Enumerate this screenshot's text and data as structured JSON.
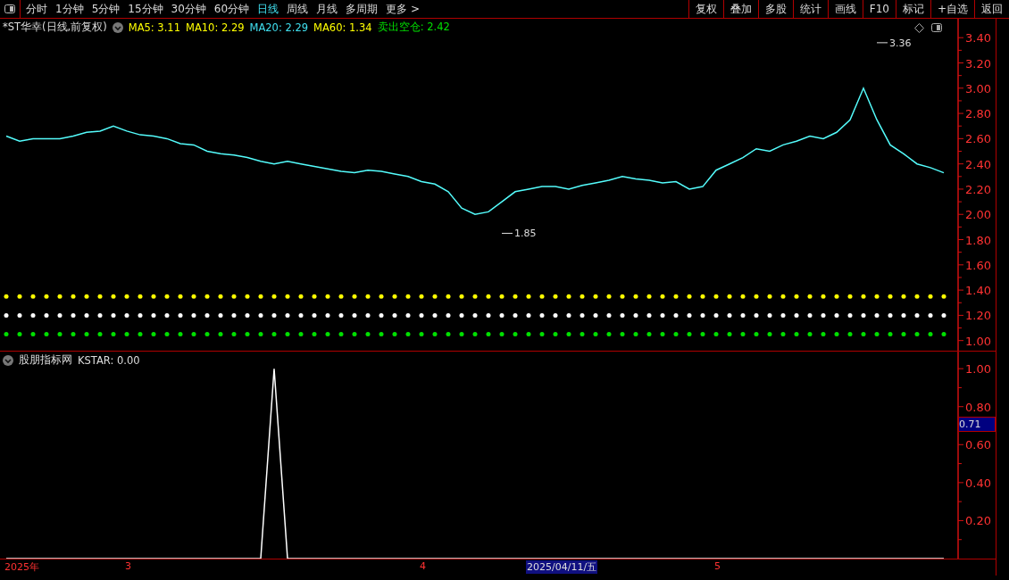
{
  "toolbar": {
    "periods": [
      {
        "label": "分时",
        "selected": false
      },
      {
        "label": "1分钟",
        "selected": false
      },
      {
        "label": "5分钟",
        "selected": false
      },
      {
        "label": "15分钟",
        "selected": false
      },
      {
        "label": "30分钟",
        "selected": false
      },
      {
        "label": "60分钟",
        "selected": false
      },
      {
        "label": "日线",
        "selected": true
      },
      {
        "label": "周线",
        "selected": false
      },
      {
        "label": "月线",
        "selected": false
      },
      {
        "label": "多周期",
        "selected": false
      },
      {
        "label": "更多 >",
        "selected": false
      }
    ],
    "buttons": [
      "复权",
      "叠加",
      "多股",
      "统计",
      "画线",
      "F10",
      "标记",
      "+自选",
      "返回"
    ]
  },
  "main_panel": {
    "title": "*ST华幸(日线,前复权)",
    "legend": [
      {
        "label": "MA5: 3.11",
        "color": "#ffff00"
      },
      {
        "label": "MA10: 2.29",
        "color": "#ffff00"
      },
      {
        "label": "MA20: 2.29",
        "color": "#40e0f0"
      },
      {
        "label": "MA60: 1.34",
        "color": "#ffff00"
      },
      {
        "label": "卖出空仓: 2.42",
        "color": "#00e000"
      }
    ],
    "price_marks": [
      {
        "label": "3.36"
      },
      {
        "label": "1.85"
      }
    ],
    "dot_rows": [
      {
        "color": "#ffff00"
      },
      {
        "color": "#ffffff"
      },
      {
        "color": "#00e000"
      }
    ],
    "chart_data": {
      "type": "line",
      "ylim": [
        0.92,
        3.55
      ],
      "yticks": [
        {
          "value": 3.4,
          "label": "3.40"
        },
        {
          "value": 3.2,
          "label": "3.20"
        },
        {
          "value": 3.0,
          "label": "3.00"
        },
        {
          "value": 2.8,
          "label": "2.80"
        },
        {
          "value": 2.6,
          "label": "2.60"
        },
        {
          "value": 2.4,
          "label": "2.40"
        },
        {
          "value": 2.2,
          "label": "2.20"
        },
        {
          "value": 2.0,
          "label": "2.00"
        },
        {
          "value": 1.8,
          "label": "1.80"
        },
        {
          "value": 1.6,
          "label": "1.60"
        },
        {
          "value": 1.4,
          "label": "1.40"
        },
        {
          "value": 1.2,
          "label": "1.20"
        },
        {
          "value": 1.0,
          "label": "1.00"
        }
      ],
      "series": [
        {
          "color": "#54fcfc",
          "values": [
            2.62,
            2.58,
            2.6,
            2.6,
            2.6,
            2.62,
            2.65,
            2.66,
            2.7,
            2.66,
            2.63,
            2.62,
            2.6,
            2.56,
            2.55,
            2.5,
            2.48,
            2.47,
            2.45,
            2.42,
            2.4,
            2.42,
            2.4,
            2.38,
            2.36,
            2.34,
            2.33,
            2.35,
            2.34,
            2.32,
            2.3,
            2.26,
            2.24,
            2.18,
            2.05,
            2.0,
            2.02,
            2.1,
            2.18,
            2.2,
            2.22,
            2.22,
            2.2,
            2.23,
            2.25,
            2.27,
            2.3,
            2.28,
            2.27,
            2.25,
            2.26,
            2.2,
            2.22,
            2.35,
            2.4,
            2.45,
            2.52,
            2.5,
            2.55,
            2.58,
            2.62,
            2.6,
            2.65,
            2.75,
            3.0,
            2.75,
            2.55,
            2.48,
            2.4,
            2.37,
            2.33
          ]
        }
      ]
    }
  },
  "indicator_panel": {
    "title": "股朋指标网",
    "reading": "KSTAR: 0.00",
    "cursor_value": "0.71",
    "chart_data": {
      "type": "line",
      "ylim": [
        0,
        1.09
      ],
      "yticks": [
        {
          "value": 1.0,
          "label": "1.00"
        },
        {
          "value": 0.8,
          "label": "0.80"
        },
        {
          "value": 0.6,
          "label": "0.60"
        },
        {
          "value": 0.4,
          "label": "0.40"
        },
        {
          "value": 0.2,
          "label": "0.20"
        }
      ],
      "series": [
        {
          "color": "#ffffff",
          "values": [
            0,
            0,
            0,
            0,
            0,
            0,
            0,
            0,
            0,
            0,
            0,
            0,
            0,
            0,
            0,
            0,
            0,
            0,
            0,
            0,
            1,
            0,
            0,
            0,
            0,
            0,
            0,
            0,
            0,
            0,
            0,
            0,
            0,
            0,
            0,
            0,
            0,
            0,
            0,
            0,
            0,
            0,
            0,
            0,
            0,
            0,
            0,
            0,
            0,
            0,
            0,
            0,
            0,
            0,
            0,
            0,
            0,
            0,
            0,
            0,
            0,
            0,
            0,
            0,
            0,
            0,
            0,
            0,
            0,
            0,
            0
          ]
        }
      ]
    }
  },
  "date_axis": [
    {
      "label": "2025年",
      "selected": false
    },
    {
      "label": "3",
      "selected": false
    },
    {
      "label": "4",
      "selected": false
    },
    {
      "label": "2025/04/11/五",
      "selected": true
    },
    {
      "label": "5",
      "selected": false
    }
  ]
}
